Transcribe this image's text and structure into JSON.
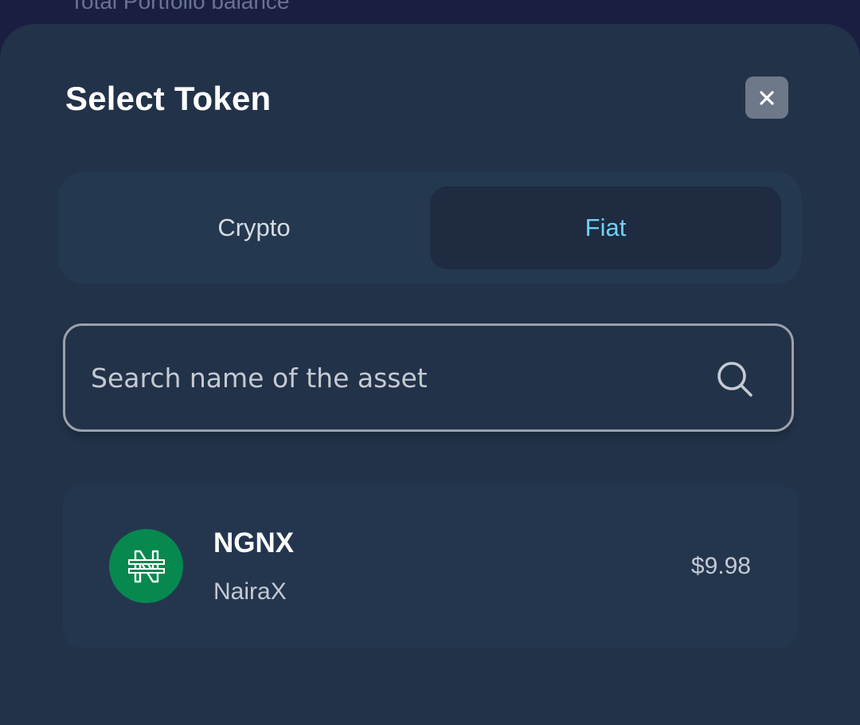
{
  "background": {
    "partial_text": "Total Portfolio balance"
  },
  "modal": {
    "title": "Select Token",
    "close_icon": "close-icon"
  },
  "tabs": [
    {
      "label": "Crypto",
      "active": false
    },
    {
      "label": "Fiat",
      "active": true
    }
  ],
  "search": {
    "placeholder": "Search name of the asset",
    "value": "",
    "icon": "search-icon"
  },
  "tokens": [
    {
      "symbol": "NGNX",
      "name": "NairaX",
      "value": "$9.98",
      "icon": "naira-icon",
      "icon_color": "#07884f"
    }
  ],
  "colors": {
    "sheet": "#223249",
    "active_tab_text": "#6fd0f5",
    "active_tab_bg": "#1e2b40",
    "close_button_bg": "#6d7888"
  }
}
